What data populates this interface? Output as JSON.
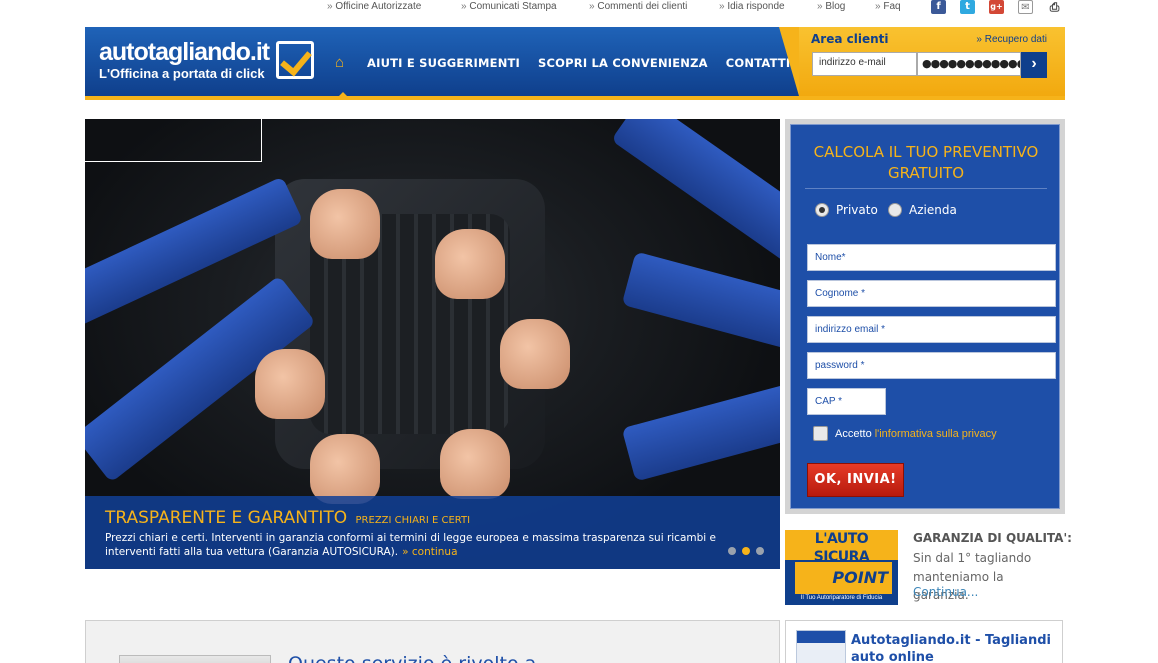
{
  "topbar": {
    "links": [
      "Officine Autorizzate",
      "Comunicati Stampa",
      "Commenti dei clienti",
      "Idia risponde",
      "Blog",
      "Faq"
    ],
    "social": [
      "facebook-icon",
      "twitter-icon",
      "google-plus-icon",
      "email-icon",
      "print-icon"
    ]
  },
  "header": {
    "logo_brand": "autotagliando.it",
    "logo_tagline": "L'Officina a portata di click",
    "nav": [
      "AIUTI E SUGGERIMENTI",
      "SCOPRI LA CONVENIENZA",
      "CONTATTI"
    ],
    "area": {
      "title": "Area clienti",
      "recover": "Recupero dati",
      "email_value": "indirizzo e-mail",
      "password_value": "●●●●●●●●●●●●"
    }
  },
  "slider": {
    "title": "TRASPARENTE E GARANTITO",
    "subtitle": "PREZZI CHIARI E CERTI",
    "text": "Prezzi chiari e certi. Interventi in garanzia conformi ai termini di legge europea e massima trasparenza sui ricambi e interventi fatti alla tua vettura (Garanzia AUTOSICURA).",
    "more": "continua",
    "active_dot": 1
  },
  "quote_form": {
    "title_line1": "CALCOLA IL TUO PREVENTIVO",
    "title_line2": "GRATUITO",
    "radio_private": "Privato",
    "radio_company": "Azienda",
    "name_placeholder": "Nome*",
    "surname_placeholder": "Cognome *",
    "email_placeholder": "indirizzo email *",
    "password_placeholder": "password *",
    "cap_placeholder": "CAP *",
    "privacy_prefix": "Accetto",
    "privacy_link": "l'informativa sulla privacy",
    "submit": "OK, INVIA!"
  },
  "guarantee": {
    "badge_top": "L'AUTO SICURA",
    "badge_mid": "POINT SERVICE",
    "badge_bottom": "Il Tuo Autoriparatore di Fiducia",
    "title": "GARANZIA DI QUALITA':",
    "text": "Sin dal 1° tagliando manteniamo la garanzia.",
    "more": "Continua..."
  },
  "bottom": {
    "left_title": "Questo servizio è rivolto a ...",
    "right_title": "Autotagliando.it - Tagliandi auto online"
  },
  "colors": {
    "brand_blue": "#1e4fa8",
    "accent_orange": "#f6b31a",
    "submit_red": "#d22a18"
  }
}
